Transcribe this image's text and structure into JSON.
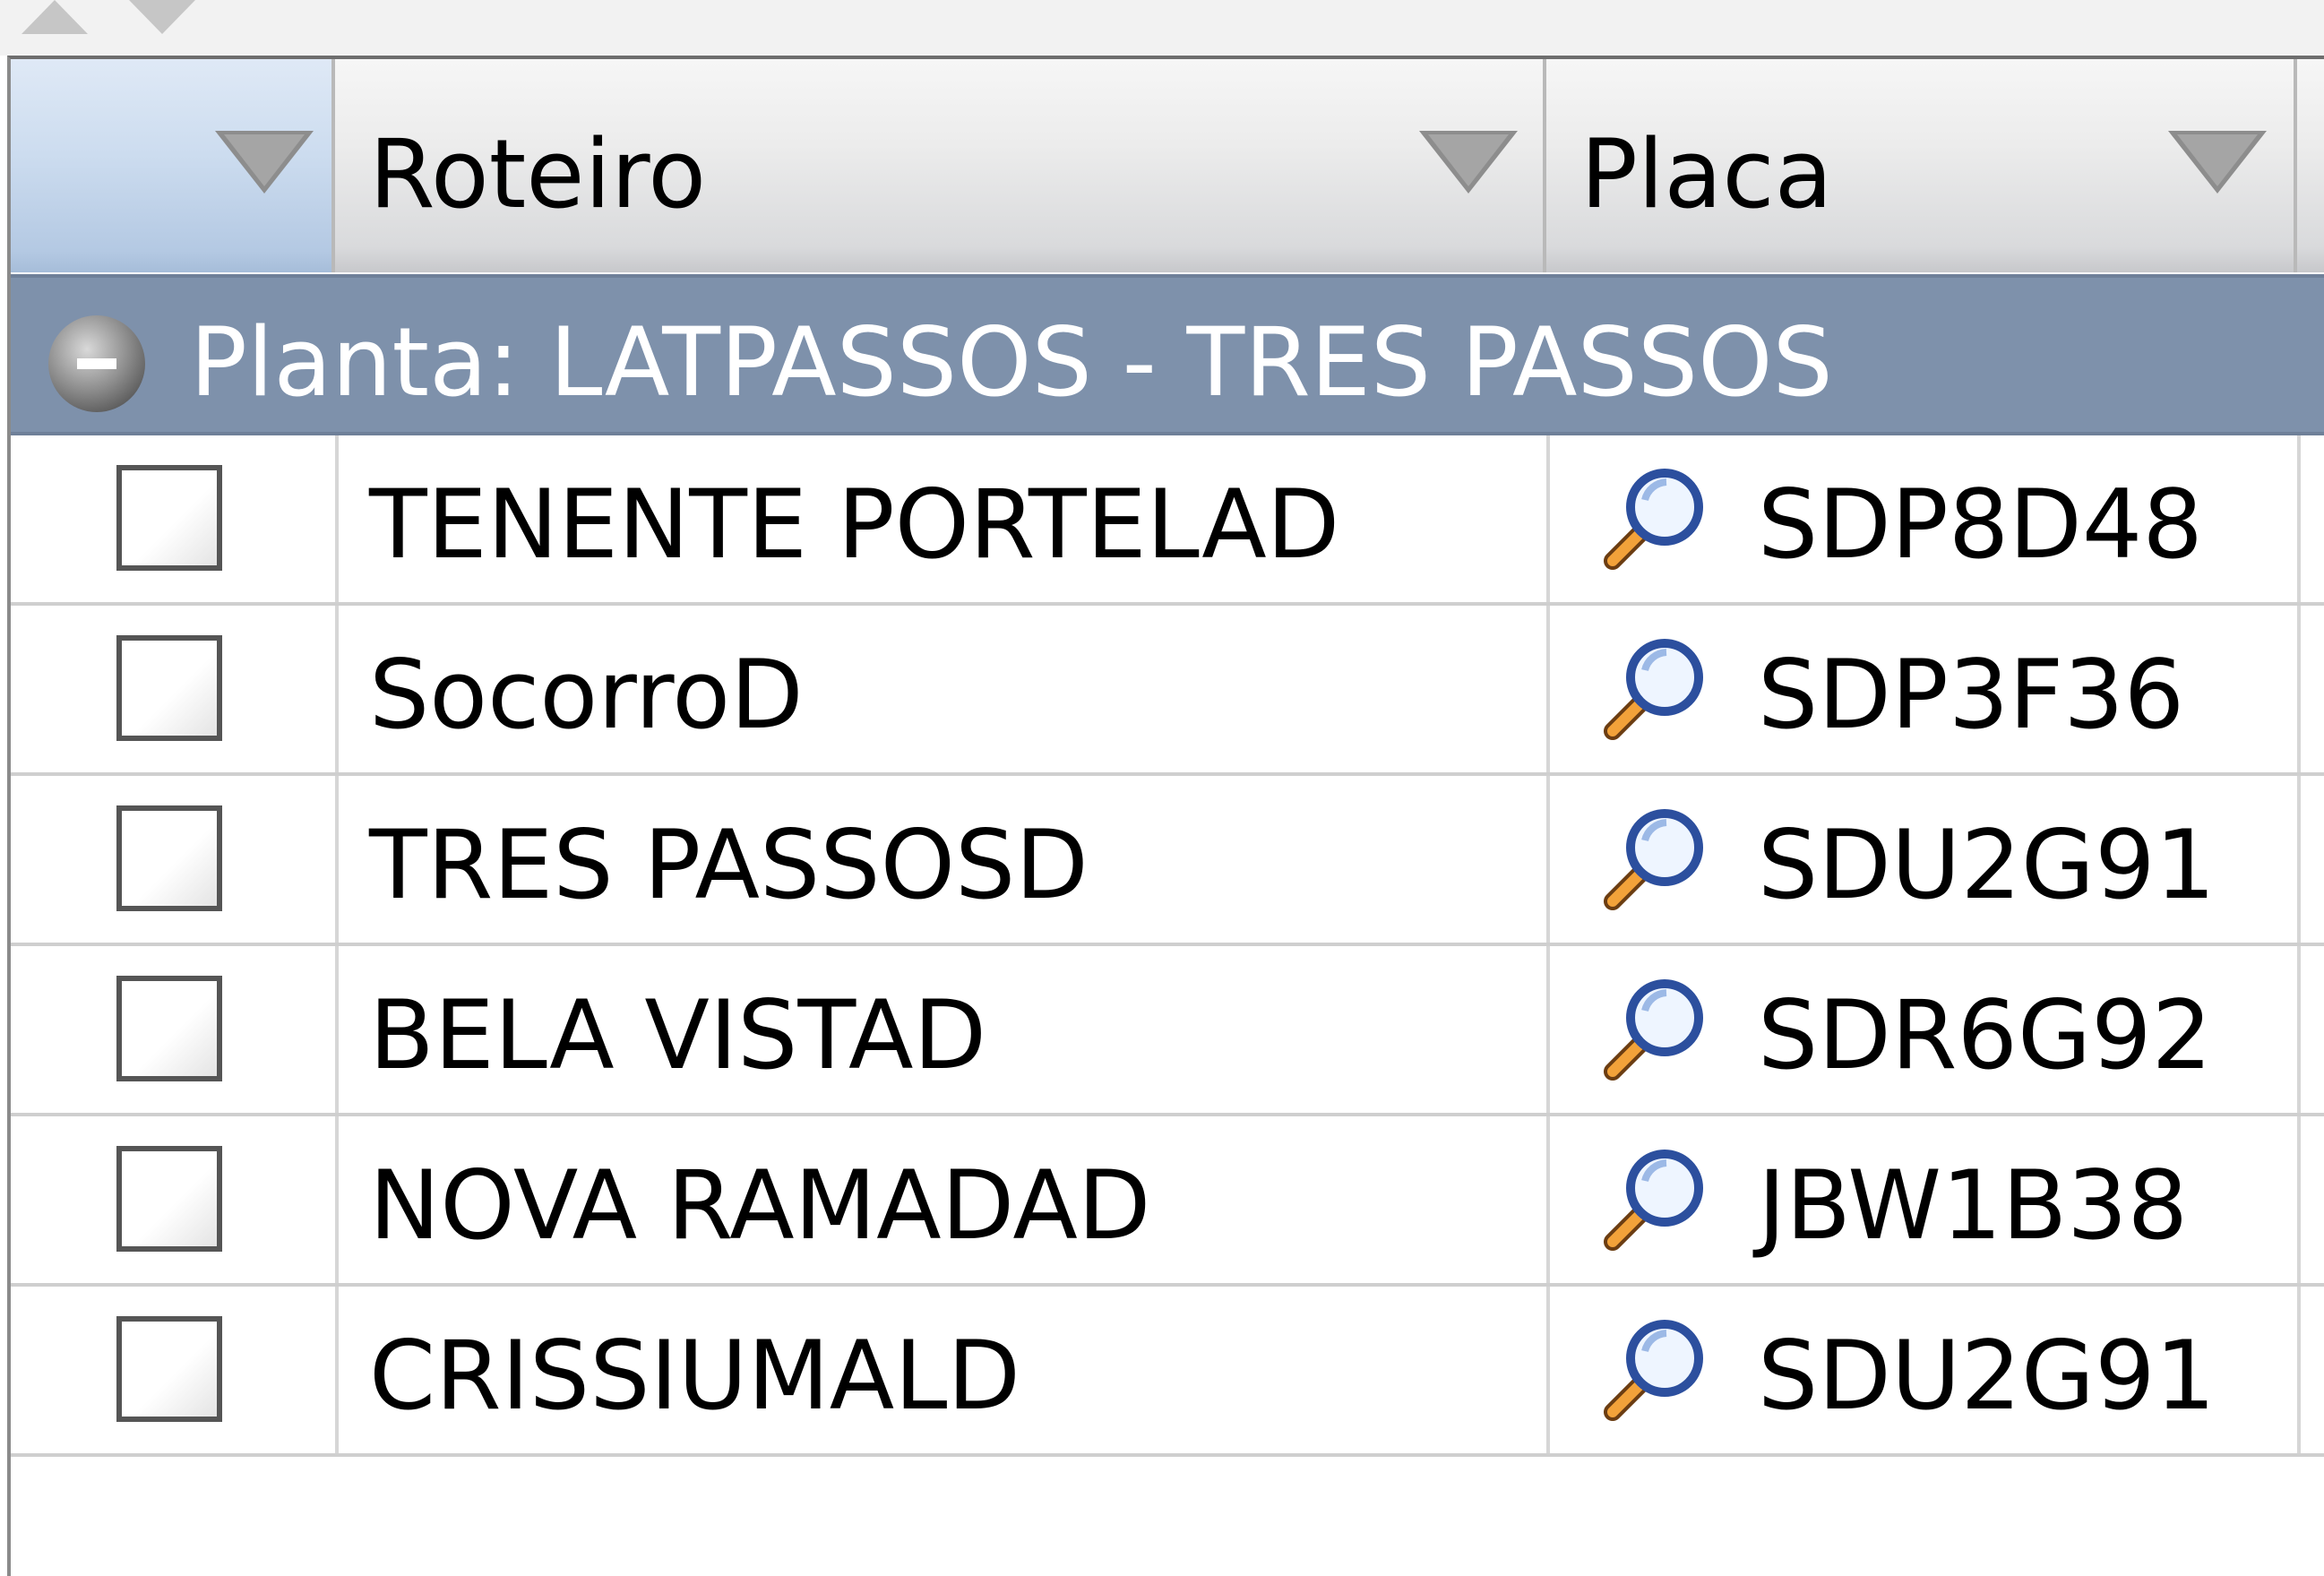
{
  "grid": {
    "columns": [
      {
        "key": "select",
        "label": ""
      },
      {
        "key": "roteiro",
        "label": "Roteiro"
      },
      {
        "key": "placa",
        "label": "Placa"
      }
    ],
    "group": {
      "label": "Planta: LATPASSOS - TRES PASSOS",
      "state": "expanded"
    },
    "rows": [
      {
        "checked": false,
        "roteiro": "TENENTE PORTELAD",
        "placa": "SDP8D48"
      },
      {
        "checked": false,
        "roteiro": "SocorroD",
        "placa": "SDP3F36"
      },
      {
        "checked": false,
        "roteiro": "TRES PASSOSD",
        "placa": "SDU2G91"
      },
      {
        "checked": false,
        "roteiro": "BELA VISTAD",
        "placa": "SDR6G92"
      },
      {
        "checked": false,
        "roteiro": "NOVA RAMADAD",
        "placa": "JBW1B38"
      },
      {
        "checked": false,
        "roteiro": "CRISSIUMALD",
        "placa": "SDU2G91"
      }
    ]
  },
  "icons": {
    "sort": "triangle-down-icon",
    "collapse": "collapse-circle-icon",
    "lookup": "magnifier-icon",
    "scroll": [
      "scroll-up-icon",
      "scroll-down-icon"
    ]
  },
  "colors": {
    "group_band": "#7e91ab",
    "selected_header": "#c4d6ec",
    "grid_line": "#cfcfcf"
  }
}
